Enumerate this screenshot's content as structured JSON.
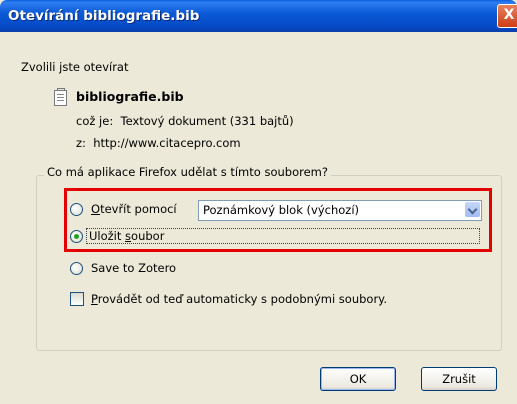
{
  "title": "Otevírání bibliografie.bib",
  "close_glyph": "X",
  "intro": "Zvolili jste otevírat",
  "file": {
    "name": "bibliografie.bib",
    "type_label": "což je:",
    "type_value": "Textový dokument (331 bajtů)",
    "from_label": "z:",
    "from_value": "http://www.citacepro.com"
  },
  "question": "Co má aplikace Firefox udělat s tímto souborem?",
  "options": {
    "open_with": {
      "accesskey": "O",
      "rest": "tevřít pomocí",
      "checked": false
    },
    "app_select_value": "Poznámkový blok (výchozí)",
    "save": {
      "pre": "Uložit ",
      "accesskey": "s",
      "rest": "oubor",
      "checked": true
    },
    "zotero": {
      "label": "Save to Zotero",
      "checked": false
    }
  },
  "auto": {
    "accesskey": "P",
    "rest": "rovádět od teď automaticky s podobnými soubory.",
    "checked": false
  },
  "buttons": {
    "ok": "OK",
    "cancel": "Zrušit"
  },
  "colors": {
    "title_bar": "#0548c4",
    "highlight": "#e40000",
    "radio_dot": "#21a121"
  }
}
